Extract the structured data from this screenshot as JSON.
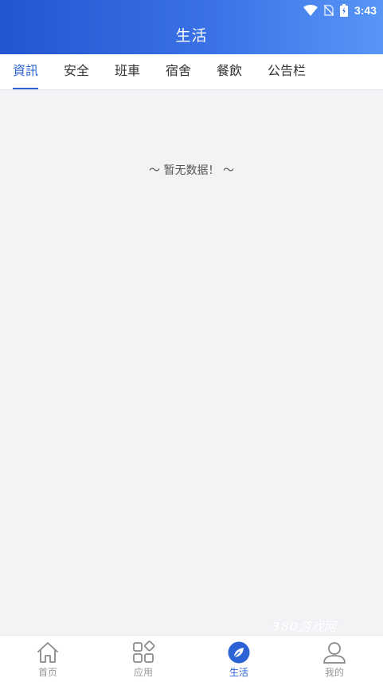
{
  "status_bar": {
    "time": "3:43",
    "icons": [
      "wifi-icon",
      "no-sim-icon",
      "battery-charging-icon"
    ]
  },
  "header": {
    "title": "生活"
  },
  "tabs": [
    {
      "label": "資訊",
      "active": true
    },
    {
      "label": "安全",
      "active": false
    },
    {
      "label": "班車",
      "active": false
    },
    {
      "label": "宿舍",
      "active": false
    },
    {
      "label": "餐飲",
      "active": false
    },
    {
      "label": "公告栏",
      "active": false
    }
  ],
  "content": {
    "empty_message": "～ 暂无数据！ ～"
  },
  "watermark": {
    "text": "380游戏网"
  },
  "bottom_nav": [
    {
      "label": "首页",
      "icon": "home-icon",
      "active": false
    },
    {
      "label": "应用",
      "icon": "apps-icon",
      "active": false
    },
    {
      "label": "生活",
      "icon": "compass-leaf-icon",
      "active": true
    },
    {
      "label": "我的",
      "icon": "user-icon",
      "active": false
    }
  ],
  "colors": {
    "accent": "#2c63d4",
    "header_start": "#2155d1",
    "header_end": "#5896f6",
    "background": "#f2f3f5"
  }
}
